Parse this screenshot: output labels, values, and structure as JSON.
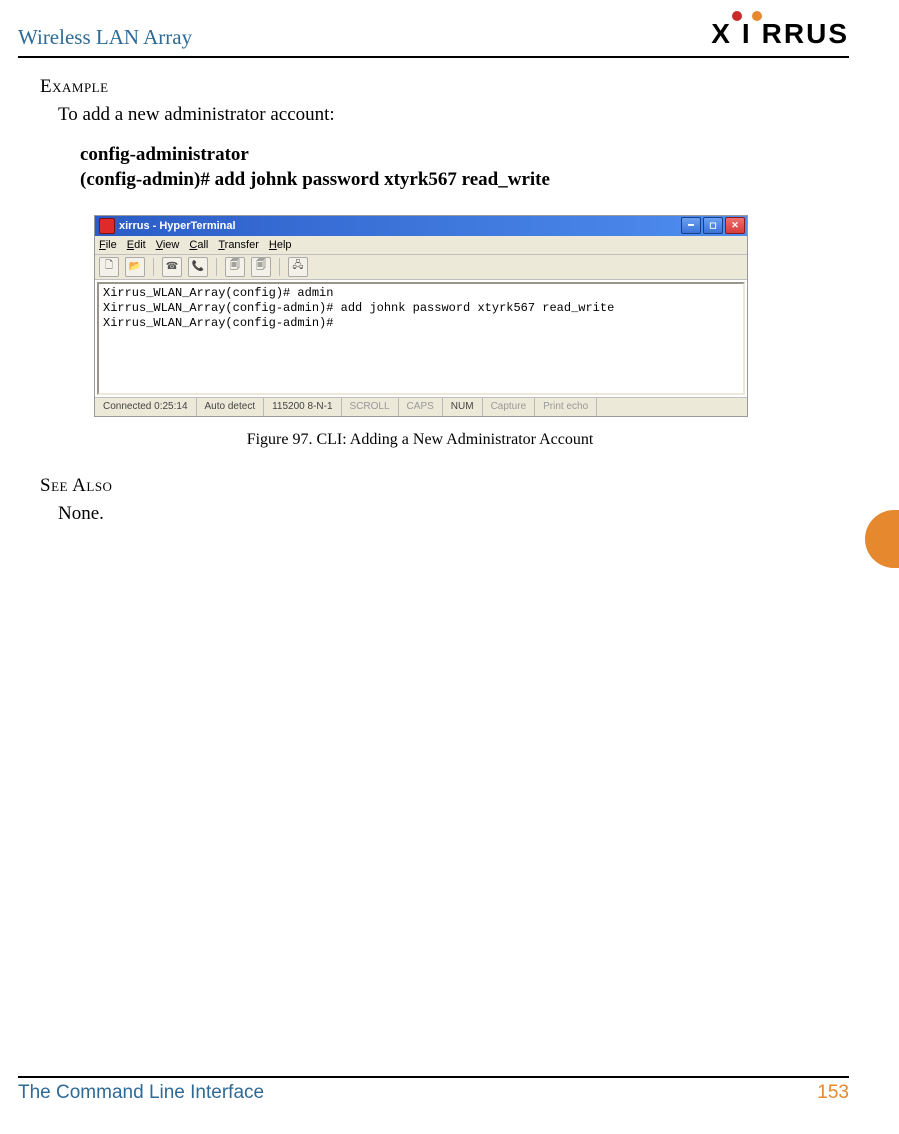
{
  "colors": {
    "header_text": "#2E6A95",
    "footer_text": "#2E6A95",
    "pagenum": "#E6882E",
    "tab": "#E6882E"
  },
  "header": {
    "title": "Wireless LAN Array",
    "brand": "XIRRUS"
  },
  "sections": {
    "example_heading": "Example",
    "example_intro": "To add a new administrator account:",
    "cmd_line1": "config-administrator",
    "cmd_line2": "(config-admin)# add johnk password xtyrk567 read_write",
    "seealso_heading": "See Also",
    "seealso_body": "None."
  },
  "hyperterm": {
    "window_title": "xirrus - HyperTerminal",
    "menu": {
      "file": "File",
      "edit": "Edit",
      "view": "View",
      "call": "Call",
      "transfer": "Transfer",
      "help": "Help"
    },
    "terminal_lines": [
      "Xirrus_WLAN_Array(config)# admin",
      "Xirrus_WLAN_Array(config-admin)# add johnk password xtyrk567 read_write",
      "Xirrus_WLAN_Array(config-admin)#"
    ],
    "status": {
      "connected": "Connected 0:25:14",
      "autodetect": "Auto detect",
      "baud": "115200 8-N-1",
      "scroll": "SCROLL",
      "caps": "CAPS",
      "num": "NUM",
      "capture": "Capture",
      "printecho": "Print echo"
    }
  },
  "figure_caption": "Figure 97. CLI: Adding a New Administrator Account",
  "footer": {
    "section": "The Command Line Interface",
    "page": "153"
  }
}
